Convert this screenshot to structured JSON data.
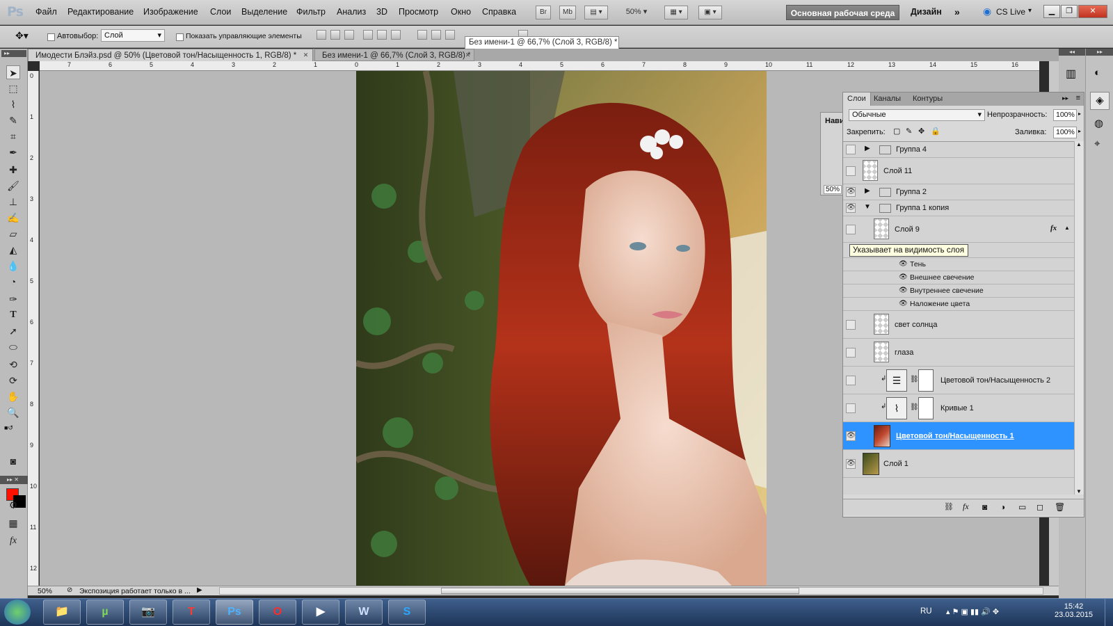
{
  "app": {
    "logo": "Ps"
  },
  "menu": [
    "Файл",
    "Редактирование",
    "Изображение",
    "Слои",
    "Выделение",
    "Фильтр",
    "Анализ",
    "3D",
    "Просмотр",
    "Окно",
    "Справка"
  ],
  "menubar_buttons": {
    "bridge": "Br",
    "minibridge": "Mb",
    "zoom": "50%"
  },
  "workspace": {
    "active": "Основная рабочая среда",
    "design": "Дизайн",
    "cslive": "CS Live"
  },
  "options": {
    "autoselect_label": "Автовыбор:",
    "autoselect_value": "Слой",
    "show_controls_label": "Показать управляющие элементы"
  },
  "tabs": [
    {
      "label": "Имодести Блэйз.psd @ 50% (Цветовой тон/Насыщенность 1, RGB/8) *"
    },
    {
      "label": "Без имени-1 @ 66,7% (Слой 3, RGB/8) *"
    }
  ],
  "tab_tooltip": "Без имени-1 @ 66,7% (Слой 3, RGB/8) *",
  "ruler_top": [
    "7",
    "6",
    "5",
    "4",
    "3",
    "2",
    "1",
    "0",
    "1",
    "2",
    "3",
    "4",
    "5",
    "6",
    "7",
    "8",
    "9",
    "10",
    "11",
    "12",
    "13",
    "14",
    "15",
    "16"
  ],
  "ruler_left": [
    "0",
    "1",
    "2",
    "3",
    "4",
    "5",
    "6",
    "7",
    "8",
    "9",
    "10",
    "11",
    "12"
  ],
  "status": {
    "zoom": "50%",
    "message": "Экспозиция работает только в ..."
  },
  "navigator": {
    "label": "Нави",
    "zoom": "50%"
  },
  "layers_panel": {
    "tabs": [
      "Слои",
      "Каналы",
      "Контуры"
    ],
    "blend_mode": "Обычные",
    "opacity_label": "Непрозрачность:",
    "opacity_value": "100%",
    "lock_label": "Закрепить:",
    "fill_label": "Заливка:",
    "fill_value": "100%",
    "tooltip": "Указывает на видимость слоя",
    "layers": [
      {
        "name": "Группа 4",
        "type": "group",
        "visible": false
      },
      {
        "name": "Слой 11",
        "type": "layer",
        "visible": false
      },
      {
        "name": "Группа 2",
        "type": "group",
        "visible": true
      },
      {
        "name": "Группа 1 копия",
        "type": "group-open",
        "visible": true
      },
      {
        "name": "Слой 9",
        "type": "layer",
        "visible": false,
        "fx": "fx"
      },
      {
        "name": "Тень",
        "type": "effect"
      },
      {
        "name": "Внешнее свечение",
        "type": "effect"
      },
      {
        "name": "Внутреннее свечение",
        "type": "effect"
      },
      {
        "name": "Наложение цвета",
        "type": "effect"
      },
      {
        "name": "свет солнца",
        "type": "layer",
        "visible": false
      },
      {
        "name": "глаза",
        "type": "layer",
        "visible": false
      },
      {
        "name": "Цветовой тон/Насыщенность 2",
        "type": "adjustment",
        "visible": false
      },
      {
        "name": "Кривые 1",
        "type": "adjustment",
        "visible": false
      },
      {
        "name": "Цветовой тон/Насыщенность 1",
        "type": "adjustment-selected",
        "visible": true
      },
      {
        "name": "Слой 1",
        "type": "layer",
        "visible": true
      }
    ]
  },
  "taskbar": {
    "lang": "RU",
    "time": "15:42",
    "date": "23.03.2015"
  },
  "colors": {
    "foreground": "#ff1100",
    "background": "#000000",
    "selection": "#2f93ff"
  }
}
